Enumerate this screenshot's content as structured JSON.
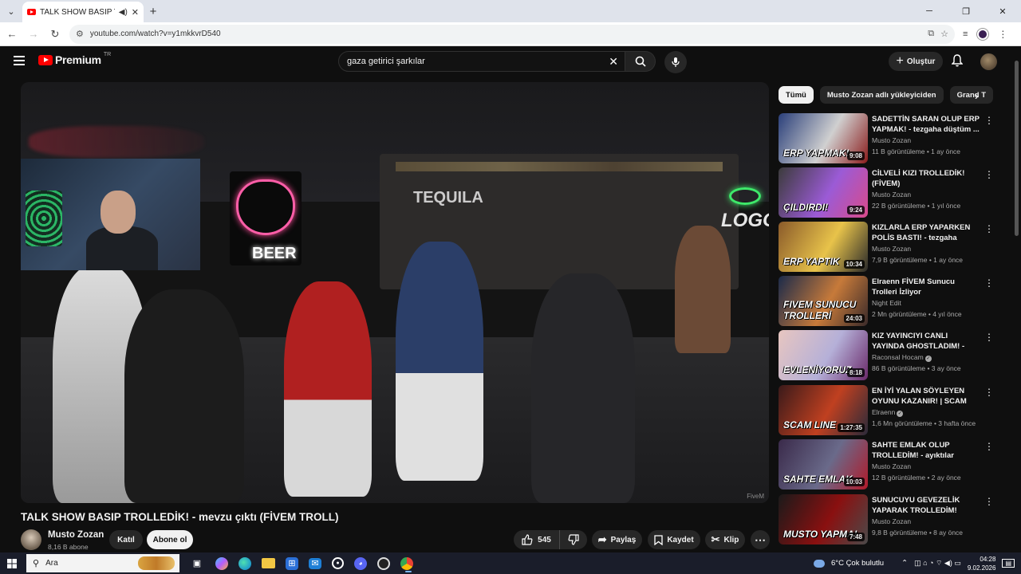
{
  "browser": {
    "tab": {
      "title": "TALK SHOW BASIP TROLLED"
    },
    "url": "youtube.com/watch?v=y1mkkvrD540",
    "window_controls": {
      "minimize": "─",
      "restore": "❐",
      "close": "✕"
    }
  },
  "header": {
    "logo_text": "Premium",
    "logo_country": "TR",
    "search_value": "gaza getirici şarkılar",
    "create_label": "Oluştur"
  },
  "video": {
    "title": "TALK SHOW BASIP TROLLEDİK! - mevzu çıktı (FİVEM TROLL)",
    "scene_text": {
      "sign1": "BEER",
      "sign2": "TEQUILA",
      "sign3": "LOGO"
    },
    "watermark": "FiveM"
  },
  "channel": {
    "name": "Musto Zozan",
    "subscribers": "8,16 B abone",
    "join_label": "Katıl",
    "subscribe_label": "Abone ol"
  },
  "actions": {
    "likes": "545",
    "share_label": "Paylaş",
    "save_label": "Kaydet",
    "clip_label": "Klip",
    "more_label": "⋯"
  },
  "sidebar": {
    "chips": [
      "Tümü",
      "Musto Zozan adlı yükleyiciden",
      "Grand T"
    ],
    "recommendations": [
      {
        "title": "SADETTİN SARAN OLUP ERP YAPMAK! - tezgaha düştüm ...",
        "channel": "Musto Zozan",
        "meta": "11 B görüntüleme • 1 ay önce",
        "duration": "9:08",
        "thumb_text": "ERP YAPMAK!",
        "verified": false
      },
      {
        "title": "CİLVELİ KIZI TROLLEDİK! (FİVEM)",
        "channel": "Musto Zozan",
        "meta": "22 B görüntüleme • 1 yıl önce",
        "duration": "9:24",
        "thumb_text": "ÇILDIRDI!",
        "verified": false
      },
      {
        "title": "KIZLARLA ERP YAPARKEN POLİS BASTI! - tezgaha düştü...",
        "channel": "Musto Zozan",
        "meta": "7,9 B görüntüleme • 1 ay önce",
        "duration": "10:34",
        "thumb_text": "ERP YAPTIK",
        "verified": false
      },
      {
        "title": "Elraenn FİVEM Sunucu Trolleri İzliyor",
        "channel": "Night Edit",
        "meta": "2 Mn görüntüleme • 4 yıl önce",
        "duration": "24:03",
        "thumb_text": "FIVEM SUNUCU TROLLERİ",
        "verified": false
      },
      {
        "title": "KIZ YAYINCIYI CANLI YAYINDA GHOSTLADIM! - kaçırdım ...",
        "channel": "Raconsal Hocam",
        "meta": "86 B görüntüleme • 3 ay önce",
        "duration": "8:18",
        "thumb_text": "EVLENİYORUZ",
        "verified": true
      },
      {
        "title": "EN İYİ YALAN SÖYLEYEN OYUNU KAZANIR! | SCAM LIN...",
        "channel": "Elraenn",
        "meta": "1,6 Mn görüntüleme • 3 hafta önce",
        "duration": "1:27:35",
        "thumb_text": "SCAM LINE",
        "verified": true
      },
      {
        "title": "SAHTE EMLAK OLUP TROLLEDİM! - ayıktılar (FİVEM...",
        "channel": "Musto Zozan",
        "meta": "12 B görüntüleme • 2 ay önce",
        "duration": "10:03",
        "thumb_text": "SAHTE EMLAK",
        "verified": false
      },
      {
        "title": "SUNUCUYU GEVEZELİK YAPARAK TROLLEDİM! (FİVE...",
        "channel": "Musto Zozan",
        "meta": "9,8 B görüntüleme • 8 ay önce",
        "duration": "7:48",
        "thumb_text": "MUSTO YAPMA!",
        "verified": false
      }
    ]
  },
  "taskbar": {
    "search_placeholder": "Ara",
    "weather": "6°C  Çok bulutlu",
    "time": "04:28",
    "date": "9.02.2026"
  },
  "colors": {
    "youtube_red": "#ff0000",
    "background": "#0f0f0f",
    "chip_bg": "#272727"
  }
}
